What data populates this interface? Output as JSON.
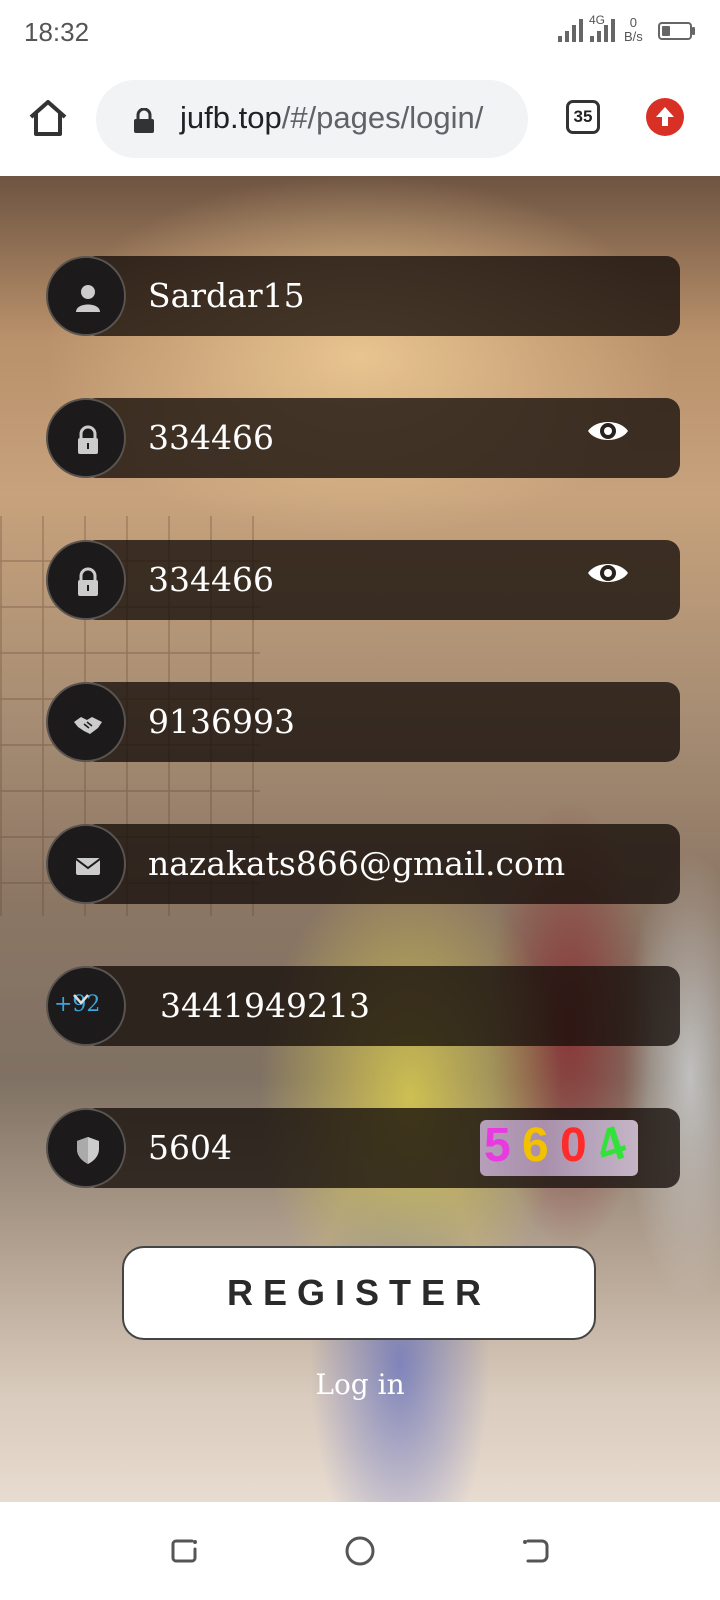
{
  "status_bar": {
    "time": "18:32",
    "network_label": "4G",
    "speed_value": "0",
    "speed_unit": "B/s"
  },
  "browser": {
    "url_domain": "jufb.top",
    "url_path": "/#/pages/login/",
    "tab_count": "35"
  },
  "form": {
    "username": "Sardar15",
    "password": "334466",
    "confirm_password": "334466",
    "invite_code": "9136993",
    "email": "nazakats866@gmail.com",
    "country_code": "+92",
    "phone": "3441949213",
    "captcha_input": "5604",
    "captcha_image_text": [
      "5",
      "6",
      "0",
      "4"
    ]
  },
  "actions": {
    "register_label": "REGISTER",
    "login_label": "Log in"
  },
  "colors": {
    "update_badge": "#d93025",
    "country_code_text": "#3aa6dd"
  }
}
